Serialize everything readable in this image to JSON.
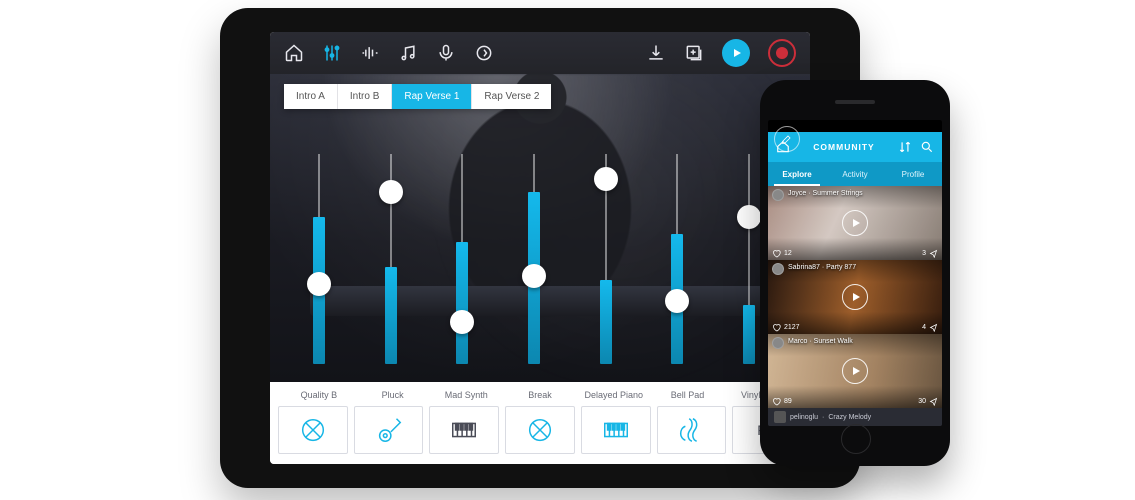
{
  "colors": {
    "accent": "#17b6e6",
    "record": "#cc2e3a",
    "toolbar_bg": "#2a2b33"
  },
  "tablet": {
    "toolbar_icons": [
      "home",
      "mixer",
      "waveform",
      "notes",
      "mic",
      "loop",
      "download",
      "add-track"
    ],
    "active_toolbar_icon": "mixer",
    "section_tabs": [
      {
        "label": "Intro A",
        "active": false
      },
      {
        "label": "Intro B",
        "active": false
      },
      {
        "label": "Rap Verse 1",
        "active": true
      },
      {
        "label": "Rap Verse 2",
        "active": false
      }
    ],
    "mixer_channels": [
      {
        "label": "Quality B",
        "level_pct": 70,
        "knob_pct": 38,
        "icon": "drum",
        "tint": "accent"
      },
      {
        "label": "Pluck",
        "level_pct": 46,
        "knob_pct": 82,
        "icon": "guitar",
        "tint": "accent"
      },
      {
        "label": "Mad Synth",
        "level_pct": 58,
        "knob_pct": 20,
        "icon": "keys",
        "tint": "dim"
      },
      {
        "label": "Break",
        "level_pct": 82,
        "knob_pct": 42,
        "icon": "drum",
        "tint": "accent"
      },
      {
        "label": "Delayed Piano",
        "level_pct": 40,
        "knob_pct": 88,
        "icon": "keys",
        "tint": "accent"
      },
      {
        "label": "Bell Pad",
        "level_pct": 62,
        "knob_pct": 30,
        "icon": "strings",
        "tint": "accent"
      },
      {
        "label": "Vinyl FX J",
        "level_pct": 28,
        "knob_pct": 70,
        "icon": "fx",
        "tint": "dim"
      }
    ]
  },
  "phone": {
    "header": {
      "title": "COMMUNITY"
    },
    "tabs": [
      {
        "label": "Explore",
        "active": true
      },
      {
        "label": "Activity",
        "active": false
      },
      {
        "label": "Profile",
        "active": false
      }
    ],
    "feed": [
      {
        "user": "Joyce",
        "track": "Summer Strings",
        "likes": 12,
        "comments": 3
      },
      {
        "user": "Sabrina87",
        "track": "Party 877",
        "likes": 2127,
        "comments": 4
      },
      {
        "user": "Marco",
        "track": "Sunset Walk",
        "likes": 89,
        "comments": 30
      }
    ],
    "now_playing": {
      "user": "pelinoglu",
      "track": "Crazy Melody"
    }
  }
}
